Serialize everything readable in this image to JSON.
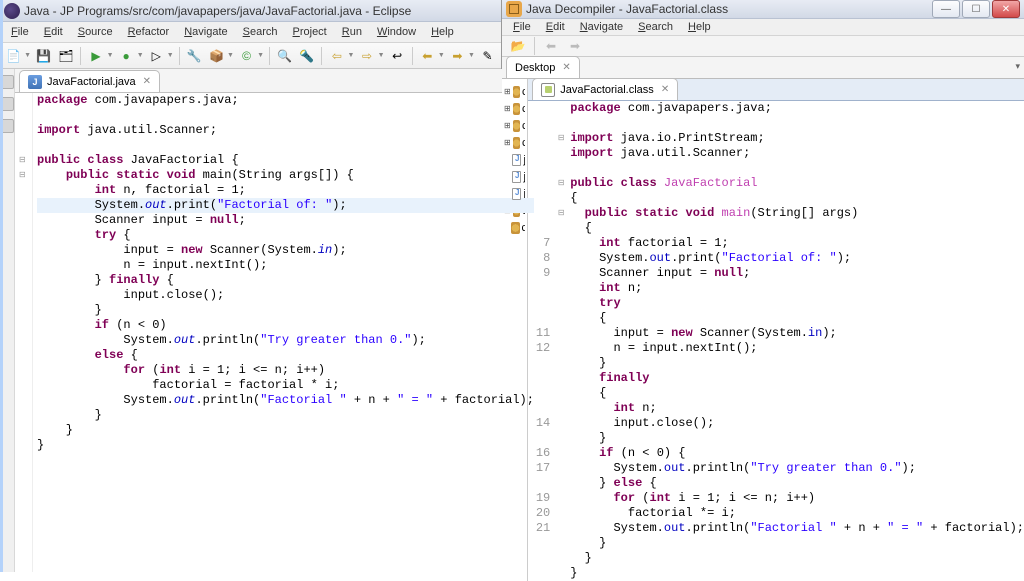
{
  "eclipse": {
    "title": "Java - JP Programs/src/com/javapapers/java/JavaFactorial.java - Eclipse",
    "menus": [
      "File",
      "Edit",
      "Source",
      "Refactor",
      "Navigate",
      "Search",
      "Project",
      "Run",
      "Window",
      "Help"
    ],
    "tab": "JavaFactorial.java",
    "tab_close": "✕"
  },
  "jd": {
    "title": "Java Decompiler - JavaFactorial.class",
    "menus": [
      "File",
      "Edit",
      "Navigate",
      "Search",
      "Help"
    ],
    "tab1": "Desktop",
    "tab2": "JavaFactorial.class",
    "tab_close": "✕",
    "tree": {
      "items": [
        "c",
        "c",
        "c",
        "c",
        "j",
        "j",
        "j",
        "c",
        "c"
      ]
    }
  },
  "eclipse_code": [
    {
      "t": "<span class='kw'>package</span> com.javapapers.java;"
    },
    {
      "t": ""
    },
    {
      "t": "<span class='kw'>import</span> java.util.Scanner;"
    },
    {
      "t": ""
    },
    {
      "t": "<span class='kw'>public class</span> JavaFactorial {"
    },
    {
      "t": "    <span class='kw'>public static void</span> main(String args[]) {"
    },
    {
      "t": "        <span class='kw'>int</span> n, factorial = 1;"
    },
    {
      "t": "        System.<span class='it'>out</span>.print(<span class='str'>\"Factorial of: \"</span>);",
      "hl": true
    },
    {
      "t": "        Scanner input = <span class='kw'>null</span>;"
    },
    {
      "t": "        <span class='kw'>try</span> {"
    },
    {
      "t": "            input = <span class='kw'>new</span> Scanner(System.<span class='it'>in</span>);"
    },
    {
      "t": "            n = input.nextInt();"
    },
    {
      "t": "        } <span class='kw'>finally</span> {"
    },
    {
      "t": "            input.close();"
    },
    {
      "t": "        }"
    },
    {
      "t": "        <span class='kw'>if</span> (n &lt; 0)"
    },
    {
      "t": "            System.<span class='it'>out</span>.println(<span class='str'>\"Try greater than 0.\"</span>);"
    },
    {
      "t": "        <span class='kw'>else</span> {"
    },
    {
      "t": "            <span class='kw'>for</span> (<span class='kw'>int</span> i = 1; i &lt;= n; i++)"
    },
    {
      "t": "                factorial = factorial * i;"
    },
    {
      "t": "            System.<span class='it'>out</span>.println(<span class='str'>\"Factorial \"</span> + n + <span class='str'>\" = \"</span> + factorial);"
    },
    {
      "t": "        }"
    },
    {
      "t": "    }"
    },
    {
      "t": "}"
    }
  ],
  "jd_code": [
    {
      "n": "",
      "t": "<span class='kw'>package</span> com.javapapers.java;"
    },
    {
      "n": "",
      "t": ""
    },
    {
      "n": "",
      "t": "<span class='kw'>import</span> java.io.PrintStream;"
    },
    {
      "n": "",
      "t": "<span class='kw'>import</span> java.util.Scanner;"
    },
    {
      "n": "",
      "t": ""
    },
    {
      "n": "",
      "t": "<span class='kw'>public class</span> <span class='pink'>JavaFactorial</span>"
    },
    {
      "n": "",
      "t": "{"
    },
    {
      "n": "",
      "t": "  <span class='kw'>public static void</span> <span class='pink'>main</span>(String[] args)"
    },
    {
      "n": "",
      "t": "  {"
    },
    {
      "n": "7",
      "t": "    <span class='kw'>int</span> factorial = 1;"
    },
    {
      "n": "8",
      "t": "    System.<span class='var'>out</span>.print(<span class='str'>\"Factorial of: \"</span>);"
    },
    {
      "n": "9",
      "t": "    Scanner input = <span class='kw'>null</span>;"
    },
    {
      "n": "",
      "t": "    <span class='kw'>int</span> n;"
    },
    {
      "n": "",
      "t": "    <span class='kw'>try</span>"
    },
    {
      "n": "",
      "t": "    {"
    },
    {
      "n": "11",
      "t": "      input = <span class='kw'>new</span> Scanner(System.<span class='var'>in</span>);"
    },
    {
      "n": "12",
      "t": "      n = input.nextInt();"
    },
    {
      "n": "",
      "t": "    }"
    },
    {
      "n": "",
      "t": "    <span class='kw'>finally</span>"
    },
    {
      "n": "",
      "t": "    {"
    },
    {
      "n": "",
      "t": "      <span class='kw'>int</span> n;"
    },
    {
      "n": "14",
      "t": "      input.close();"
    },
    {
      "n": "",
      "t": "    }"
    },
    {
      "n": "16",
      "t": "    <span class='kw'>if</span> (n &lt; 0) {"
    },
    {
      "n": "17",
      "t": "      System.<span class='var'>out</span>.println(<span class='str'>\"Try greater than 0.\"</span>);"
    },
    {
      "n": "",
      "t": "    } <span class='kw'>else</span> {"
    },
    {
      "n": "19",
      "t": "      <span class='kw'>for</span> (<span class='kw'>int</span> i = 1; i &lt;= n; i++)"
    },
    {
      "n": "20",
      "t": "        factorial *= i;"
    },
    {
      "n": "21",
      "t": "      System.<span class='var'>out</span>.println(<span class='str'>\"Factorial \"</span> + n + <span class='str'>\" = \"</span> + factorial);"
    },
    {
      "n": "",
      "t": "    }"
    },
    {
      "n": "",
      "t": "  }"
    },
    {
      "n": "",
      "t": "}"
    }
  ]
}
